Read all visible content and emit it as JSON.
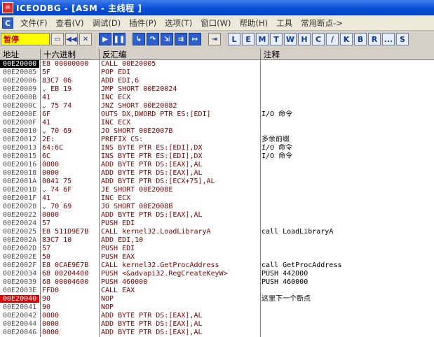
{
  "titlebar": {
    "icon_text": "☠",
    "title": "ICEODBG - [ASM - 主线程 ]"
  },
  "menubar": {
    "mdi_icon": "C",
    "items": [
      "文件(F)",
      "查看(V)",
      "调试(D)",
      "插件(P)",
      "选项(T)",
      "窗口(W)",
      "帮助(H)",
      "工具",
      "常用断点->"
    ]
  },
  "toolbar": {
    "status": "暂停",
    "icon_buttons": [
      "open-icon",
      "rewind-icon",
      "close-icon",
      "run-icon",
      "pause-icon",
      "step-into-icon",
      "step-over-icon",
      "trace-into-icon",
      "trace-over-icon",
      "execute-till-return-icon",
      "goto-icon"
    ],
    "letters": [
      "L",
      "E",
      "M",
      "T",
      "W",
      "H",
      "C",
      "/",
      "K",
      "B",
      "R",
      "...",
      "S"
    ]
  },
  "columns": {
    "addr": "地址",
    "hex": "十六进制",
    "disasm": "反汇编",
    "comment": "注释"
  },
  "rows": [
    {
      "addr": "00E20000",
      "hex": "E8 00000000",
      "disasm": "CALL 00E20005",
      "comment": "",
      "state": "selected"
    },
    {
      "addr": "00E20005",
      "hex": "5F",
      "disasm": "POP EDI",
      "comment": ""
    },
    {
      "addr": "00E20006",
      "hex": "83C7 06",
      "disasm": "ADD EDI,6",
      "comment": ""
    },
    {
      "addr": "00E20009",
      "hex": "EB 19",
      "disasm": "JMP SHORT 00E20024",
      "comment": "",
      "jump": "⌄"
    },
    {
      "addr": "00E2000B",
      "hex": "41",
      "disasm": "INC ECX",
      "comment": ""
    },
    {
      "addr": "00E2000C",
      "hex": "75 74",
      "disasm": "JNZ SHORT 00E20082",
      "comment": "",
      "jump": "⌄"
    },
    {
      "addr": "00E2000E",
      "hex": "6F",
      "disasm": "OUTS DX,DWORD PTR ES:[EDI]",
      "comment": "I/O 命令"
    },
    {
      "addr": "00E2000F",
      "hex": "41",
      "disasm": "INC ECX",
      "comment": ""
    },
    {
      "addr": "00E20010",
      "hex": "70 69",
      "disasm": "JO SHORT 00E2007B",
      "comment": "",
      "jump": "⌄"
    },
    {
      "addr": "00E20012",
      "hex": "2E:",
      "disasm": "PREFIX CS:",
      "comment": "多余前缀"
    },
    {
      "addr": "00E20013",
      "hex": "64:6C",
      "disasm": "INS BYTE PTR ES:[EDI],DX",
      "comment": "I/O 命令"
    },
    {
      "addr": "00E20015",
      "hex": "6C",
      "disasm": "INS BYTE PTR ES:[EDI],DX",
      "comment": "I/O 命令"
    },
    {
      "addr": "00E20016",
      "hex": "0000",
      "disasm": "ADD BYTE PTR DS:[EAX],AL",
      "comment": ""
    },
    {
      "addr": "00E20018",
      "hex": "0000",
      "disasm": "ADD BYTE PTR DS:[EAX],AL",
      "comment": ""
    },
    {
      "addr": "00E2001A",
      "hex": "0041 75",
      "disasm": "ADD BYTE PTR DS:[ECX+75],AL",
      "comment": ""
    },
    {
      "addr": "00E2001D",
      "hex": "74 6F",
      "disasm": "JE SHORT 00E2008E",
      "comment": "",
      "jump": "⌄"
    },
    {
      "addr": "00E2001F",
      "hex": "41",
      "disasm": "INC ECX",
      "comment": ""
    },
    {
      "addr": "00E20020",
      "hex": "70 69",
      "disasm": "JO SHORT 00E2008B",
      "comment": "",
      "jump": "⌄"
    },
    {
      "addr": "00E20022",
      "hex": "0000",
      "disasm": "ADD BYTE PTR DS:[EAX],AL",
      "comment": ""
    },
    {
      "addr": "00E20024",
      "hex": "57",
      "disasm": "PUSH EDI",
      "comment": ""
    },
    {
      "addr": "00E20025",
      "hex": "E8 511D9E7B",
      "disasm": "CALL kernel32.LoadLibraryA",
      "comment": "call LoadLibraryA"
    },
    {
      "addr": "00E2002A",
      "hex": "83C7 10",
      "disasm": "ADD EDI,10",
      "comment": ""
    },
    {
      "addr": "00E2002D",
      "hex": "57",
      "disasm": "PUSH EDI",
      "comment": ""
    },
    {
      "addr": "00E2002E",
      "hex": "50",
      "disasm": "PUSH EAX",
      "comment": ""
    },
    {
      "addr": "00E2002F",
      "hex": "E8 0CAE9E7B",
      "disasm": "CALL kernel32.GetProcAddress",
      "comment": "call GetProcAddress"
    },
    {
      "addr": "00E20034",
      "hex": "68 00204400",
      "disasm": "PUSH <&advapi32.RegCreateKeyW>",
      "comment": "PUSH 442000"
    },
    {
      "addr": "00E20039",
      "hex": "68 00004600",
      "disasm": "PUSH 460000",
      "comment": "PUSH 460000"
    },
    {
      "addr": "00E2003E",
      "hex": "FFD0",
      "disasm": "CALL EAX",
      "comment": ""
    },
    {
      "addr": "00E20040",
      "hex": "90",
      "disasm": "NOP",
      "comment": "这里下一个断点",
      "state": "breakpoint"
    },
    {
      "addr": "00E20041",
      "hex": "90",
      "disasm": "NOP",
      "comment": ""
    },
    {
      "addr": "00E20042",
      "hex": "0000",
      "disasm": "ADD BYTE PTR DS:[EAX],AL",
      "comment": ""
    },
    {
      "addr": "00E20044",
      "hex": "0000",
      "disasm": "ADD BYTE PTR DS:[EAX],AL",
      "comment": ""
    },
    {
      "addr": "00E20046",
      "hex": "0000",
      "disasm": "ADD BYTE PTR DS:[EAX],AL",
      "comment": ""
    }
  ],
  "colors": {
    "selected_bg": "#000000",
    "breakpoint_bg": "#e00000",
    "code_text": "#800000"
  }
}
